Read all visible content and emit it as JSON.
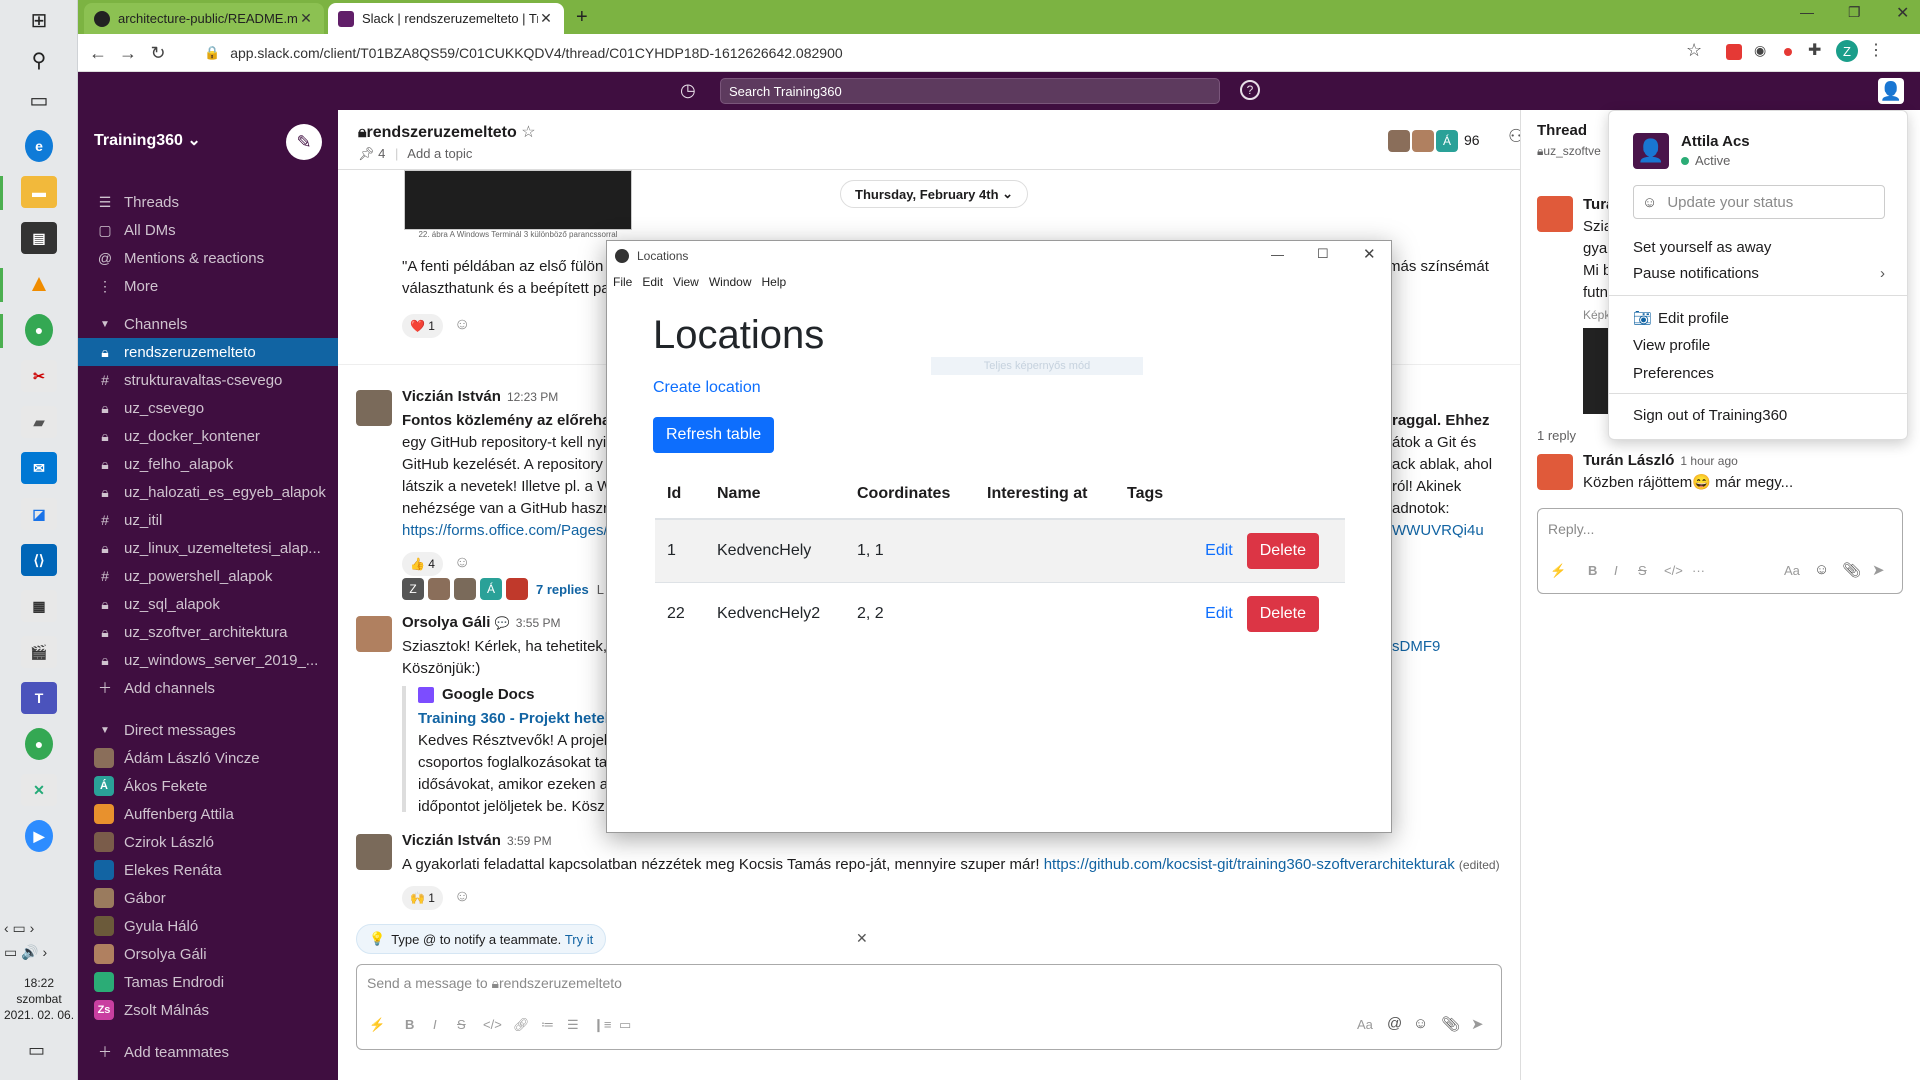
{
  "taskbar": {
    "clock_time": "18:22",
    "clock_day": "szombat",
    "clock_date": "2021. 02. 06."
  },
  "browser": {
    "tabs": [
      {
        "title": "architecture-public/README.md",
        "active": false
      },
      {
        "title": "Slack | rendszeruzemelteto | Trai",
        "active": true
      }
    ],
    "url": "app.slack.com/client/T01BZA8QS59/C01CUKKQDV4/thread/C01CYHDP18D-1612626642.082900",
    "profile_initial": "Z"
  },
  "slack_top": {
    "search_placeholder": "Search Training360"
  },
  "sidebar": {
    "workspace": "Training360",
    "nav": [
      {
        "label": "Threads",
        "icon": "threads-icon"
      },
      {
        "label": "All DMs",
        "icon": "dms-icon"
      },
      {
        "label": "Mentions & reactions",
        "icon": "at-icon"
      },
      {
        "label": "More",
        "icon": "more-icon"
      }
    ],
    "channels_header": "Channels",
    "channels": [
      {
        "name": "rendszeruzemelteto",
        "private": true,
        "active": true
      },
      {
        "name": "strukturavaltas-csevego",
        "private": false
      },
      {
        "name": "uz_csevego",
        "private": true
      },
      {
        "name": "uz_docker_kontener",
        "private": true
      },
      {
        "name": "uz_felho_alapok",
        "private": true
      },
      {
        "name": "uz_halozati_es_egyeb_alapok",
        "private": true
      },
      {
        "name": "uz_itil",
        "private": false
      },
      {
        "name": "uz_linux_uzemeltetesi_alap...",
        "private": true
      },
      {
        "name": "uz_powershell_alapok",
        "private": false
      },
      {
        "name": "uz_sql_alapok",
        "private": true
      },
      {
        "name": "uz_szoftver_architektura",
        "private": true
      },
      {
        "name": "uz_windows_server_2019_...",
        "private": true
      }
    ],
    "add_channels": "Add channels",
    "dm_header": "Direct messages",
    "dms": [
      {
        "name": "Ádám László Vincze",
        "color": "#8a6e5a",
        "initial": ""
      },
      {
        "name": "Ákos Fekete",
        "color": "#2aa198",
        "initial": "Á"
      },
      {
        "name": "Auffenberg Attila",
        "color": "#e8912d",
        "initial": ""
      },
      {
        "name": "Czirok László",
        "color": "#7a5c4a",
        "initial": ""
      },
      {
        "name": "Elekes Renáta",
        "color": "#1264a3",
        "initial": ""
      },
      {
        "name": "Gábor",
        "color": "#9a7b5e",
        "initial": ""
      },
      {
        "name": "Gyula Háló",
        "color": "#6b5a3a",
        "initial": ""
      },
      {
        "name": "Orsolya Gáli",
        "color": "#b08060",
        "initial": ""
      },
      {
        "name": "Tamas Endrodi",
        "color": "#2bac76",
        "initial": ""
      },
      {
        "name": "Zsolt Málnás",
        "color": "#c93fa0",
        "initial": "Zs"
      }
    ],
    "add_teammates": "Add teammates"
  },
  "channel": {
    "name": "rendszeruzemelteto",
    "pins": "4",
    "topic_placeholder": "Add a topic",
    "member_count": "96",
    "date_divider": "Thursday, February 4th",
    "image_caption": "22. ábra A Windows Terminál 3 különböző parancssorral",
    "msg0_line1": "\"A fenti példában az első fülön a",
    "msg0_line1_right": "más színsémát",
    "msg0_line2": "választhatunk és a beépített pa",
    "msg0_reaction": "1",
    "messages": [
      {
        "author": "Viczián István",
        "time": "12:23 PM",
        "lines": [
          "Fontos közlemény az előrehalac",
          "egy GitHub repository-t kell nyi",
          "GitHub kezelését. A repository",
          "látszik a nevetek! Illetve pl. a W",
          "nehézsége van a GitHub haszna"
        ],
        "right_lines": [
          "raggal. Ehhez",
          "átok a Git és",
          "ack ablak, ahol",
          "ról! Akinek",
          "adnotok:"
        ],
        "link_left": "https://forms.office.com/Pages/",
        "link_right": "WWUVRQi4u",
        "reaction": "4",
        "replies": "7 replies",
        "replies_tail": "L"
      },
      {
        "author": "Orsolya Gáli",
        "time": "3:55 PM",
        "line1": "Sziasztok! Kérlek, ha tehetitek,",
        "line1_right": "sDMF9",
        "line2": "Köszönjük:)",
        "attachment_source": "Google Docs",
        "attachment_title": "Training 360 - Projekt hetek",
        "attachment_lines": [
          "Kedves Résztvevők! A projek",
          "csoportos foglalkozásokat tar",
          "idősávokat, amikor ezeken a",
          "időpontot jelöljetek be. Kösz"
        ]
      },
      {
        "author": "Viczián István",
        "time": "3:59 PM",
        "text": "A gyakorlati feladattal kapcsolatban nézzétek meg Kocsis Tamás repo-ját, mennyire szuper már!",
        "link": "https://github.com/kocsist-git/training360-szoftverarchitekturak",
        "edited": "(edited)",
        "reaction": "1"
      }
    ],
    "hint_text": "Type @ to notify a teammate.",
    "hint_link": "Try it",
    "composer_placeholder": "Send a message to",
    "composer_channel": "rendszeruzemelteto"
  },
  "thread": {
    "title": "Thread",
    "channel": "uz_szoftve",
    "reply_count": "1 reply",
    "snippet_lines": [
      "Turá",
      "Szia",
      "gyak",
      "Mi b",
      "futn",
      "Képk"
    ],
    "reply_author": "Turán László",
    "reply_time": "1 hour ago",
    "reply_text": "Közben rájöttem😄 már megy...",
    "reply_placeholder": "Reply..."
  },
  "locations_window": {
    "window_title": "Locations",
    "menu": [
      "File",
      "Edit",
      "View",
      "Window",
      "Help"
    ],
    "heading": "Locations",
    "create_link": "Create location",
    "refresh_button": "Refresh table",
    "faint_text": "Teljes képernyős mód",
    "columns": [
      "Id",
      "Name",
      "Coordinates",
      "Interesting at",
      "Tags"
    ],
    "rows": [
      {
        "id": "1",
        "name": "KedvencHely",
        "coordinates": "1, 1",
        "interesting_at": "",
        "tags": "",
        "edit": "Edit",
        "delete": "Delete"
      },
      {
        "id": "22",
        "name": "KedvencHely2",
        "coordinates": "2, 2",
        "interesting_at": "",
        "tags": "",
        "edit": "Edit",
        "delete": "Delete"
      }
    ]
  },
  "profile_menu": {
    "name": "Attila Acs",
    "status": "Active",
    "status_placeholder": "Update your status",
    "away": "Set yourself as away",
    "pause": "Pause notifications",
    "edit_profile": "Edit profile",
    "view_profile": "View profile",
    "preferences": "Preferences",
    "sign_out": "Sign out of Training360"
  },
  "colors": {
    "sidebar_bg": "#3f0e40",
    "active_channel": "#1164a3",
    "chrome_frame": "#7cb342",
    "link": "#1264a3",
    "primary_button": "#0d6efd",
    "danger_button": "#dc3545"
  }
}
